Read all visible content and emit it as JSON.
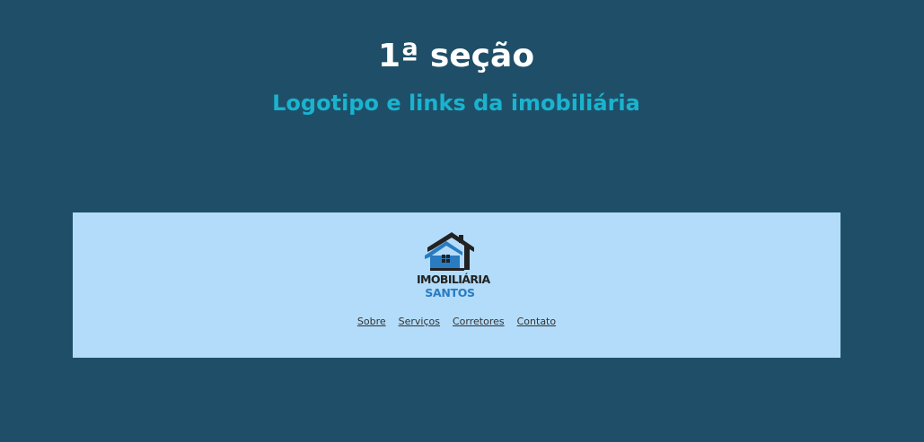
{
  "slide": {
    "title": "1ª seção",
    "subtitle": "Logotipo e links da imobiliária"
  },
  "header": {
    "logo": {
      "icon": "house-icon",
      "line1": "IMOBILIÁRIA",
      "line2": "SANTOS"
    },
    "nav": [
      {
        "label": "Sobre"
      },
      {
        "label": "Serviços"
      },
      {
        "label": "Corretores"
      },
      {
        "label": "Contato"
      }
    ]
  },
  "colors": {
    "background": "#1f4f68",
    "title": "#ffffff",
    "subtitle": "#1ab3cf",
    "header_bg": "#b3dcfa",
    "logo_blue": "#2a7bc0",
    "logo_dark": "#222222",
    "link": "#333333"
  }
}
